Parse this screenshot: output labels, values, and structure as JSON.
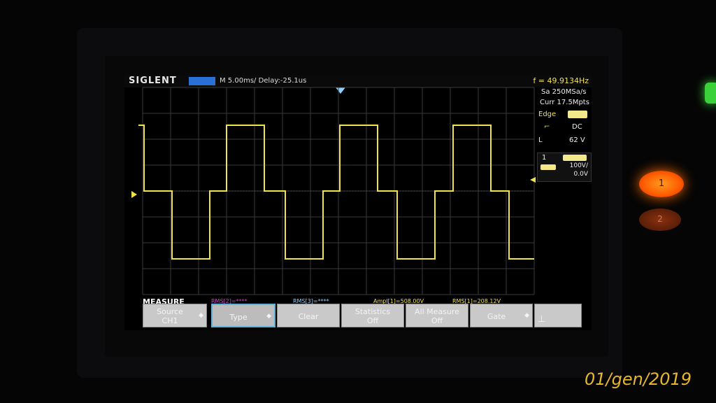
{
  "scope": {
    "brand": "SIGLENT",
    "timebase": "M 5.00ms/ Delay:-25.1us",
    "frequency": "f = 49.9134Hz",
    "sample_rate": "Sa 250MSa/s",
    "curr_depth": "Curr 17.5Mpts",
    "trigger": {
      "type": "Edge",
      "coupling": "DC",
      "level_label": "L",
      "level": "62 V"
    },
    "channel": {
      "number": "1",
      "scale": "100V/",
      "offset": "0.0V"
    },
    "menu_title": "MEASURE",
    "measurements": [
      "RMS[2]=****",
      "RMS[3]=****",
      "Ampl[1]=508.00V",
      "RMS[1]=208.12V"
    ],
    "softkeys": [
      {
        "line1": "Source",
        "line2": "CH1",
        "arrow": true
      },
      {
        "line1": "Type",
        "line2": "",
        "arrow": true,
        "selected": true
      },
      {
        "line1": "Clear",
        "line2": ""
      },
      {
        "line1": "Statistics",
        "line2": "Off"
      },
      {
        "line1": "All Measure",
        "line2": "Off"
      },
      {
        "line1": "Gate",
        "line2": "",
        "arrow": true
      },
      {
        "line1": "",
        "line2": "",
        "icon": "network-icon"
      }
    ]
  },
  "panel": {
    "button1": "1",
    "button2": "2"
  },
  "datestamp": "01/gen/2019",
  "colors": {
    "trace": "#f2e24a",
    "accent_blue": "#2a6fd6",
    "button1": "#ff6a00",
    "led": "#3bd13b",
    "date": "#e8b62a"
  }
}
